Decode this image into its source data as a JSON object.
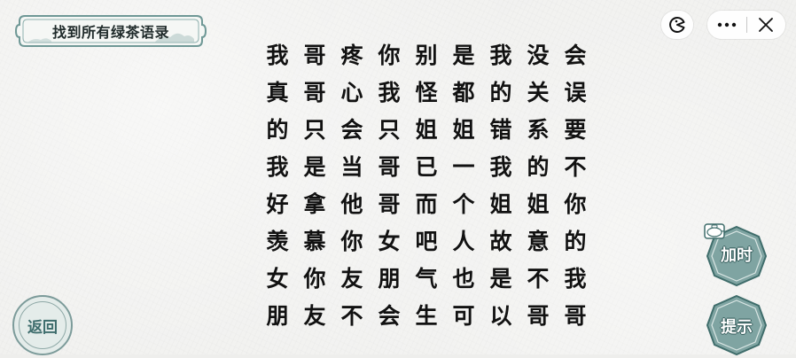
{
  "header": {
    "title": "找到所有绿茶语录"
  },
  "topbar": {
    "game_icon": "game-controller-icon",
    "more_icon": "more-dots-icon",
    "close_icon": "close-icon"
  },
  "grid": {
    "rows": [
      [
        "我",
        "哥",
        "疼",
        "你",
        "别",
        "是",
        "我",
        "没",
        "会"
      ],
      [
        "真",
        "哥",
        "心",
        "我",
        "怪",
        "都",
        "的",
        "关",
        "误"
      ],
      [
        "的",
        "只",
        "会",
        "只",
        "姐",
        "姐",
        "错",
        "系",
        "要"
      ],
      [
        "我",
        "是",
        "当",
        "哥",
        "已",
        "一",
        "我",
        "的",
        "不"
      ],
      [
        "好",
        "拿",
        "他",
        "哥",
        "而",
        "个",
        "姐",
        "姐",
        "你"
      ],
      [
        "羡",
        "慕",
        "你",
        "女",
        "吧",
        "人",
        "故",
        "意",
        "的"
      ],
      [
        "女",
        "你",
        "友",
        "朋",
        "气",
        "也",
        "是",
        "不",
        "我"
      ],
      [
        "朋",
        "友",
        "不",
        "会",
        "生",
        "可",
        "以",
        "哥",
        "哥"
      ]
    ]
  },
  "buttons": {
    "back": "返回",
    "add_time": "加时",
    "hint": "提示"
  },
  "colors": {
    "accent": "#6f9896",
    "accent_dark": "#3f6d6b",
    "text": "#111111"
  }
}
